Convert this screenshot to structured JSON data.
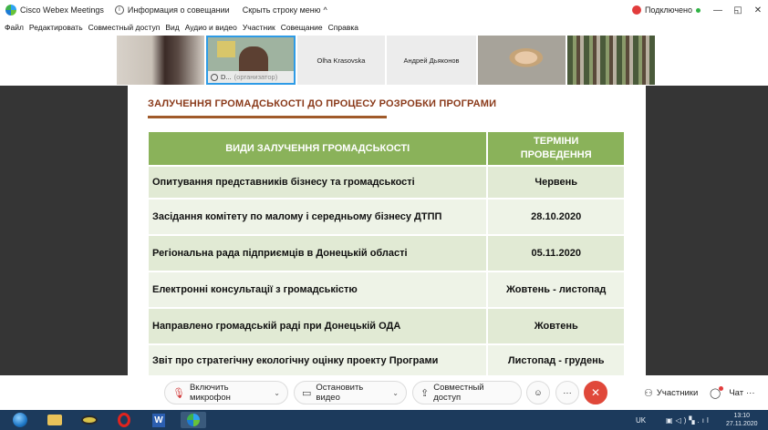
{
  "titlebar": {
    "app_title": "Cisco Webex Meetings",
    "meeting_info": "Информация о совещании",
    "hide_menu": "Скрыть строку меню",
    "hide_menu_caret": "^",
    "connection_status": "Подключено",
    "minimize": "—",
    "maximize": "◱",
    "close": "✕"
  },
  "menubar": {
    "items": [
      "Файл",
      "Редактировать",
      "Совместный доступ",
      "Вид",
      "Аудио и видео",
      "Участник",
      "Совещание",
      "Справка"
    ]
  },
  "participants": {
    "host_name": "D...",
    "host_role": "(организатор)",
    "tile3_name": "Olha Krasovska",
    "tile4_name": "Андрей Дьяконов"
  },
  "slide": {
    "title": "ЗАЛУЧЕННЯ ГРОМАДСЬКОСТІ ДО ПРОЦЕСУ РОЗРОБКИ ПРОГРАМИ",
    "table": {
      "col_type": "ВИДИ ЗАЛУЧЕННЯ ГРОМАДСЬКОСТІ",
      "col_date_line1": "ТЕРМІНИ",
      "col_date_line2": "ПРОВЕДЕННЯ",
      "rows": [
        {
          "type": "Опитування представників бізнесу та громадськості",
          "date": "Червень"
        },
        {
          "type": "Засідання комітету по малому і середньому бізнесу ДТПП",
          "date": "28.10.2020"
        },
        {
          "type": "Регіональна рада підприємців в Донецькій області",
          "date": "05.11.2020"
        },
        {
          "type": "Електронні консультації з громадськістю",
          "date": "Жовтень - листопад"
        },
        {
          "type": "Направлено громадській раді при Донецькій ОДА",
          "date": "Жовтень"
        },
        {
          "type": "Звіт про стратегічну екологічну оцінку проекту Програми",
          "date": "Листопад - грудень"
        }
      ]
    }
  },
  "controls": {
    "mic_label": "Включить микрофон",
    "video_label": "Остановить видео",
    "share_label": "Совместный доступ",
    "participants_label": "Участники",
    "chat_label": "Чат",
    "more": "···",
    "end": "✕",
    "chevron": "⌄"
  },
  "taskbar": {
    "word_letter": "W",
    "lang": "UK",
    "time": "13:10",
    "date": "27.11.2020"
  },
  "colors": {
    "slide_title": "#8a3a1a",
    "table_header": "#8ab25a",
    "table_row": "#e1ead4",
    "end_button": "#e0483a",
    "stage_bg": "#353535"
  }
}
